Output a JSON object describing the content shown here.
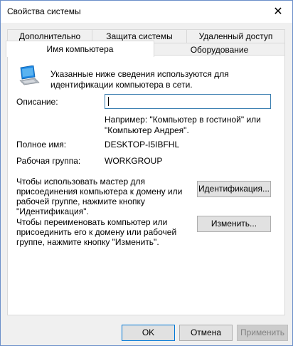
{
  "window": {
    "title": "Свойства системы",
    "close_symbol": "✕"
  },
  "tabs_top": [
    "Дополнительно",
    "Защита системы",
    "Удаленный доступ"
  ],
  "tabs_bottom": {
    "active": "Имя компьютера",
    "other": "Оборудование"
  },
  "info_text": [
    "Указанные ниже сведения используются для",
    "идентификации компьютера в сети."
  ],
  "description": {
    "label": "Описание:",
    "value": "",
    "hint": [
      "Например: \"Компьютер в гостиной\" или",
      "\"Компьютер Андрея\"."
    ]
  },
  "full_name": {
    "label": "Полное имя:",
    "value": "DESKTOP-I5IBFHL"
  },
  "workgroup": {
    "label": "Рабочая группа:",
    "value": "WORKGROUP"
  },
  "identify_section": {
    "text": [
      "Чтобы использовать мастер для",
      "присоединения компьютера к домену или",
      "рабочей группе, нажмите кнопку",
      "\"Идентификация\"."
    ],
    "button": "Идентификация..."
  },
  "rename_section": {
    "text": [
      "Чтобы переименовать компьютер или",
      "присоединить его к домену или рабочей",
      "группе, нажмите кнопку \"Изменить\"."
    ],
    "button": "Изменить..."
  },
  "dialog_buttons": {
    "ok": "OK",
    "cancel": "Отмена",
    "apply": "Применить"
  },
  "icons": {
    "computer": "computer-icon",
    "close": "close-icon"
  },
  "colors": {
    "accent": "#0078d7",
    "window_border": "#6b8fc9",
    "icon_blue": "#1e88e5"
  }
}
